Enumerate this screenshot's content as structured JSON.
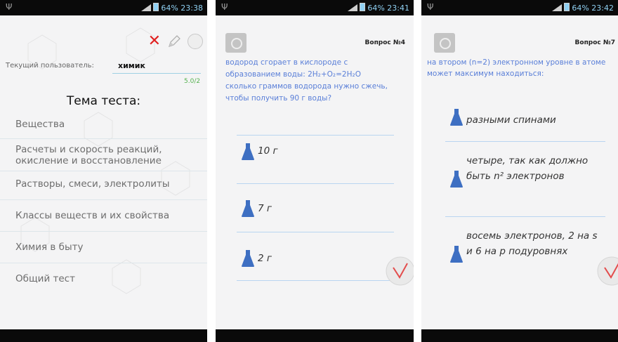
{
  "status": {
    "s1_time": "64% 23:38",
    "s2_time": "64% 23:41",
    "s3_time": "64% 23:42"
  },
  "screen1": {
    "user_label": "Текущий пользователь:",
    "user_value": "химик",
    "score": "5.0/2",
    "theme_title": "Тема теста:",
    "topics": [
      "Вещества",
      "Расчеты и скорость реакций, окисление и восстановление",
      "Растворы, смеси, электролиты",
      "Классы веществ и их свойства",
      "Химия в быту",
      "Общий тест"
    ]
  },
  "screen2": {
    "question_number": "Вопрос №4",
    "question_line1": "водород сгорает в кислороде с образованием воды: 2H₂+O₂=2H₂O",
    "question_line2": "сколько граммов водорода нужно сжечь, чтобы получить 90 г воды?",
    "answers": [
      "10 г",
      "7 г",
      "2 г"
    ]
  },
  "screen3": {
    "question_number": "Вопрос №7",
    "question": "на втором (n=2) электронном уровне в атоме может максимум находиться:",
    "answers": [
      "разными спинами",
      "четыре, так как должно быть n² электронов",
      "восемь электронов, 2 на s и 6 на p подуровнях"
    ]
  },
  "colors": {
    "question_text": "#5a7fd8",
    "delete_red": "#e02020",
    "score_green": "#55b24f",
    "flask_blue": "#3e6fc2",
    "check_red": "#e34c4c"
  }
}
